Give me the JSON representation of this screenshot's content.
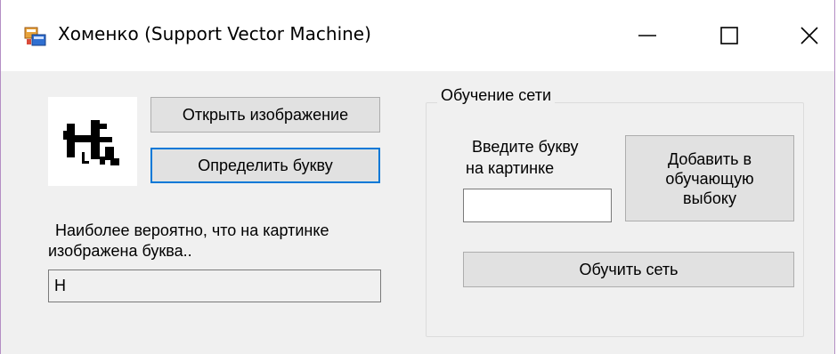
{
  "window": {
    "title": "Хоменко (Support Vector Machine)",
    "icon": "winforms-app-icon",
    "controls": [
      "minimize-icon",
      "maximize-icon",
      "close-icon"
    ]
  },
  "left_panel": {
    "open_image_label": "Открыть изображение",
    "detect_letter_label": "Определить букву",
    "result_caption_line1": "Наиболее вероятно, что на картинке",
    "result_caption_line2": "изображена буква..",
    "result_value": "Н"
  },
  "training_group": {
    "title": "Обучение сети",
    "enter_letter_line1": "Введите букву",
    "enter_letter_line2": "на картинке",
    "letter_input_value": "",
    "add_sample_line1": "Добавить в",
    "add_sample_line2": "обучающую",
    "add_sample_line3": "выбоку",
    "train_label": "Обучить сеть"
  },
  "colors": {
    "window_bg": "#f0f0f0",
    "button_bg": "#e1e1e1",
    "focus_accent": "#0078d7",
    "frame_border": "#b48ec4"
  }
}
